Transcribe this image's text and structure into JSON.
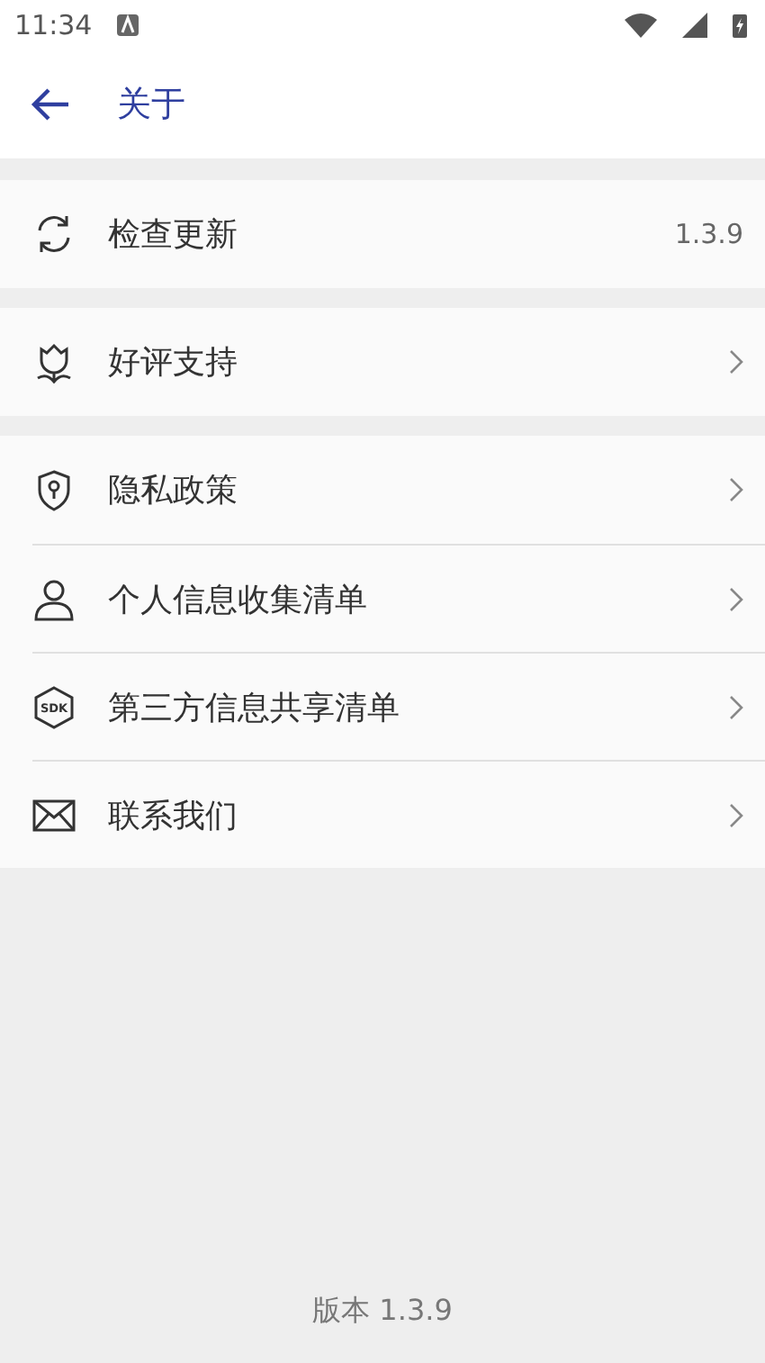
{
  "status_bar": {
    "time": "11:34"
  },
  "toolbar": {
    "title": "关于"
  },
  "groups": [
    {
      "items": [
        {
          "label": "检查更新",
          "kind": "value",
          "value": "1.3.9"
        }
      ]
    },
    {
      "items": [
        {
          "label": "好评支持",
          "kind": "link"
        }
      ]
    },
    {
      "items": [
        {
          "label": "隐私政策",
          "kind": "link"
        },
        {
          "label": "个人信息收集清单",
          "kind": "link"
        },
        {
          "label": "第三方信息共享清单",
          "kind": "link",
          "badge": "SDK"
        },
        {
          "label": "联系我们",
          "kind": "link"
        }
      ]
    }
  ],
  "footer": {
    "version": "版本 1.3.9"
  }
}
